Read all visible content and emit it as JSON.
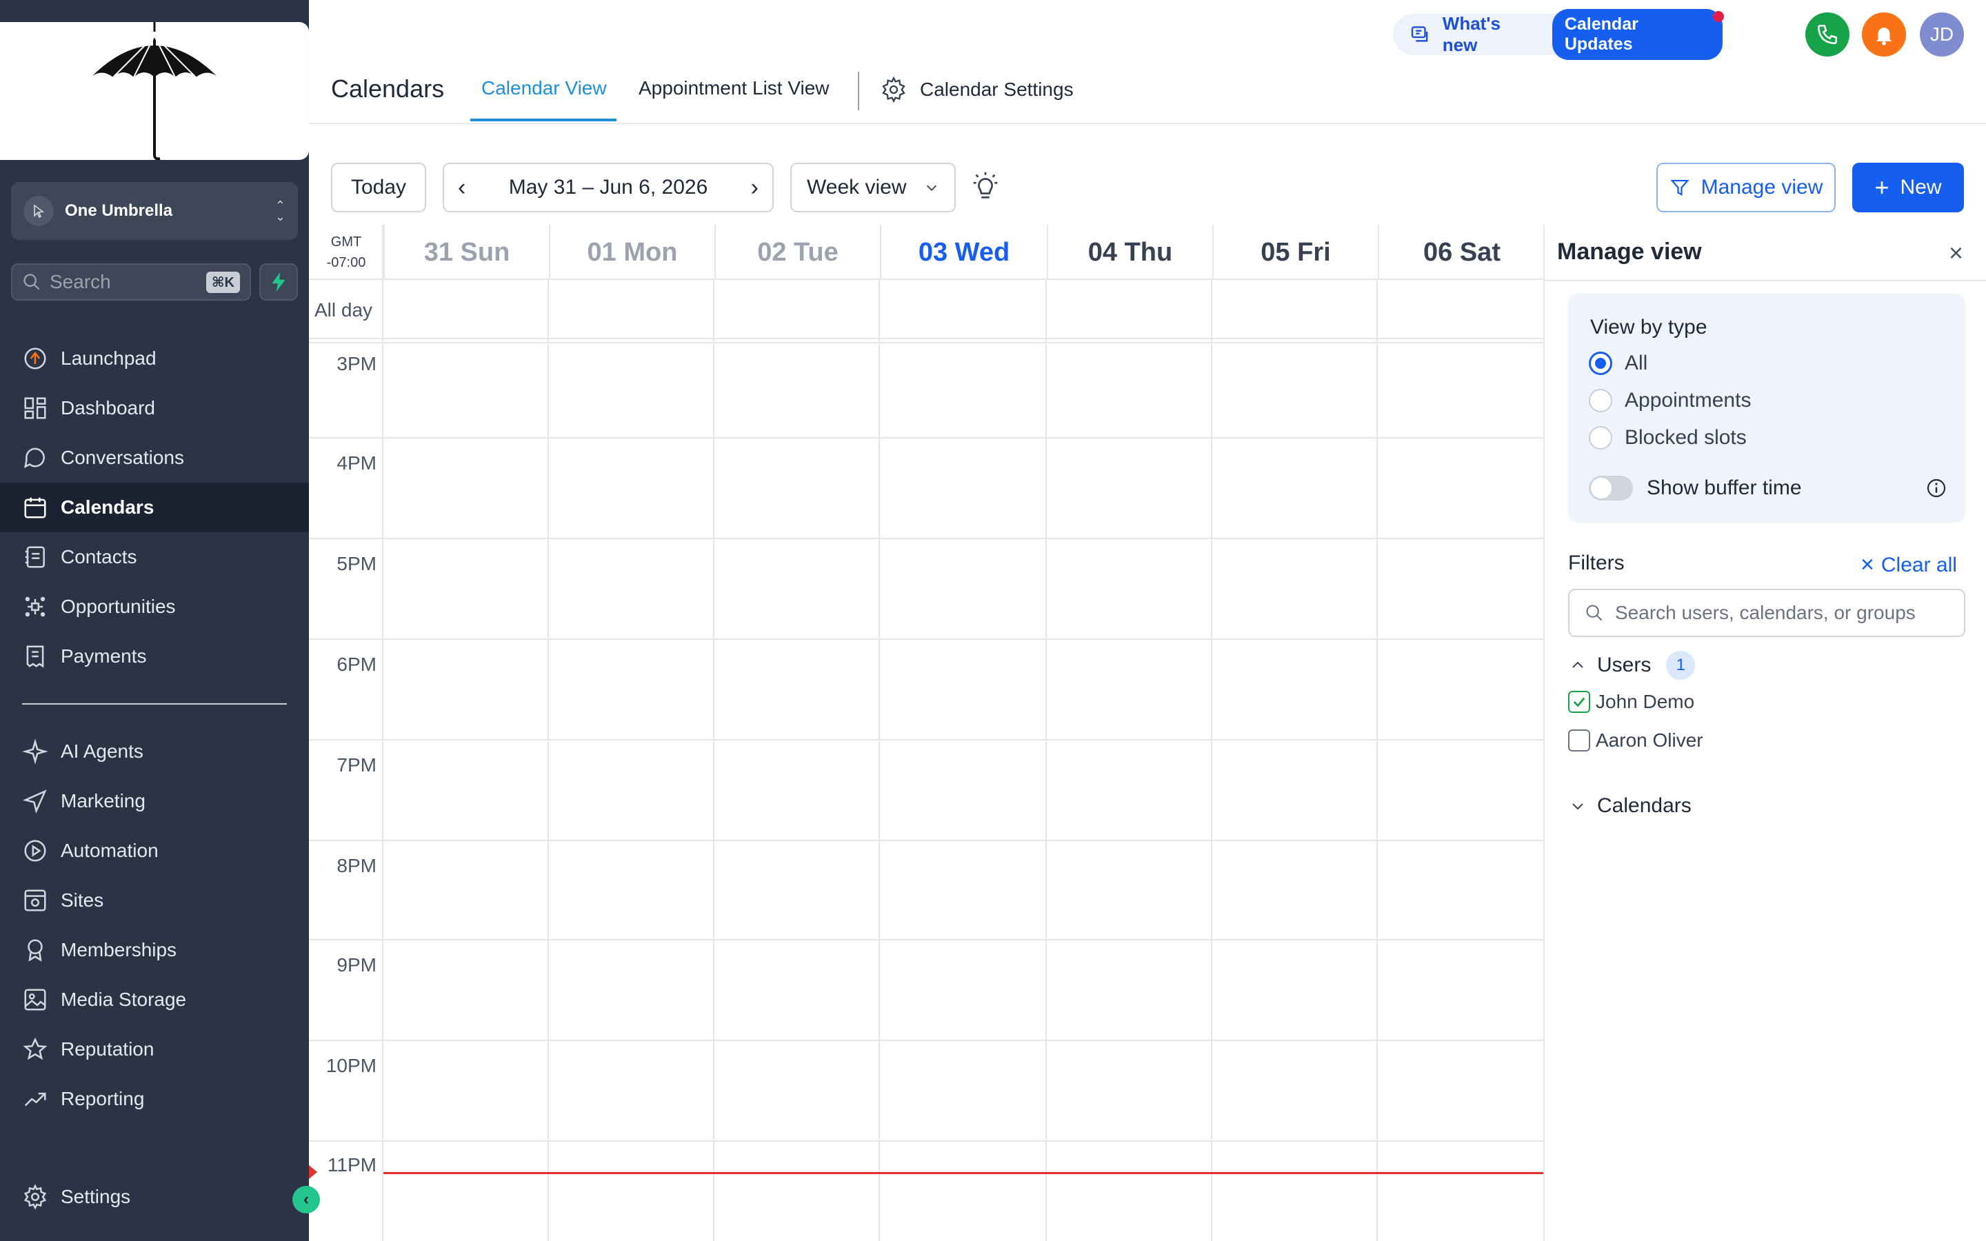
{
  "sidebar": {
    "account_name": "One Umbrella",
    "search_placeholder": "Search",
    "search_shortcut": "⌘K",
    "nav_primary": [
      {
        "label": "Launchpad",
        "icon": "launchpad-icon"
      },
      {
        "label": "Dashboard",
        "icon": "dashboard-icon"
      },
      {
        "label": "Conversations",
        "icon": "chat-bubble-icon"
      },
      {
        "label": "Calendars",
        "icon": "calendar-icon",
        "active": true
      },
      {
        "label": "Contacts",
        "icon": "contacts-icon"
      },
      {
        "label": "Opportunities",
        "icon": "opportunities-icon"
      },
      {
        "label": "Payments",
        "icon": "payments-icon"
      }
    ],
    "nav_secondary": [
      {
        "label": "AI Agents",
        "icon": "sparkles-icon"
      },
      {
        "label": "Marketing",
        "icon": "send-icon"
      },
      {
        "label": "Automation",
        "icon": "automation-icon"
      },
      {
        "label": "Sites",
        "icon": "sites-icon"
      },
      {
        "label": "Memberships",
        "icon": "badge-icon"
      },
      {
        "label": "Media Storage",
        "icon": "image-icon"
      },
      {
        "label": "Reputation",
        "icon": "star-icon"
      },
      {
        "label": "Reporting",
        "icon": "trend-icon"
      }
    ],
    "settings_label": "Settings"
  },
  "header": {
    "whats_new": "What's new",
    "updates_pill": "Calendar Updates",
    "avatar_initials": "JD",
    "page_title": "Calendars",
    "tabs": [
      "Calendar View",
      "Appointment List View",
      "Calendar Settings"
    ]
  },
  "toolbar": {
    "today": "Today",
    "date_range": "May 31 – Jun 6, 2026",
    "view_select": "Week view",
    "manage_view": "Manage view",
    "new": "New"
  },
  "calendar": {
    "timezone": [
      "GMT",
      "-07:00"
    ],
    "all_day": "All day",
    "days": [
      {
        "label": "31 Sun",
        "state": "past"
      },
      {
        "label": "01 Mon",
        "state": "past"
      },
      {
        "label": "02 Tue",
        "state": "past"
      },
      {
        "label": "03 Wed",
        "state": "today"
      },
      {
        "label": "04 Thu",
        "state": "future"
      },
      {
        "label": "05 Fri",
        "state": "future"
      },
      {
        "label": "06 Sat",
        "state": "future"
      }
    ],
    "hours": [
      "3PM",
      "4PM",
      "5PM",
      "6PM",
      "7PM",
      "8PM",
      "9PM",
      "10PM",
      "11PM"
    ]
  },
  "manage_panel": {
    "title": "Manage view",
    "view_by_type": "View by type",
    "types": [
      {
        "label": "All",
        "selected": true
      },
      {
        "label": "Appointments",
        "selected": false
      },
      {
        "label": "Blocked slots",
        "selected": false
      }
    ],
    "buffer_toggle": "Show buffer time",
    "filters": "Filters",
    "clear_all": "Clear all",
    "filter_search_placeholder": "Search users, calendars, or groups",
    "users_label": "Users",
    "users_count": "1",
    "users": [
      {
        "name": "John Demo",
        "checked": true
      },
      {
        "name": "Aaron Oliver",
        "checked": false
      }
    ],
    "calendars_label": "Calendars"
  },
  "colors": {
    "sidebar_bg": "#2a3445",
    "accent_blue": "#155eef",
    "tab_active": "#1d8fd8",
    "now_line": "#e0312f",
    "phone_green": "#16a34a",
    "bell_orange": "#f97316",
    "avatar_purple": "#7f8ccf"
  }
}
